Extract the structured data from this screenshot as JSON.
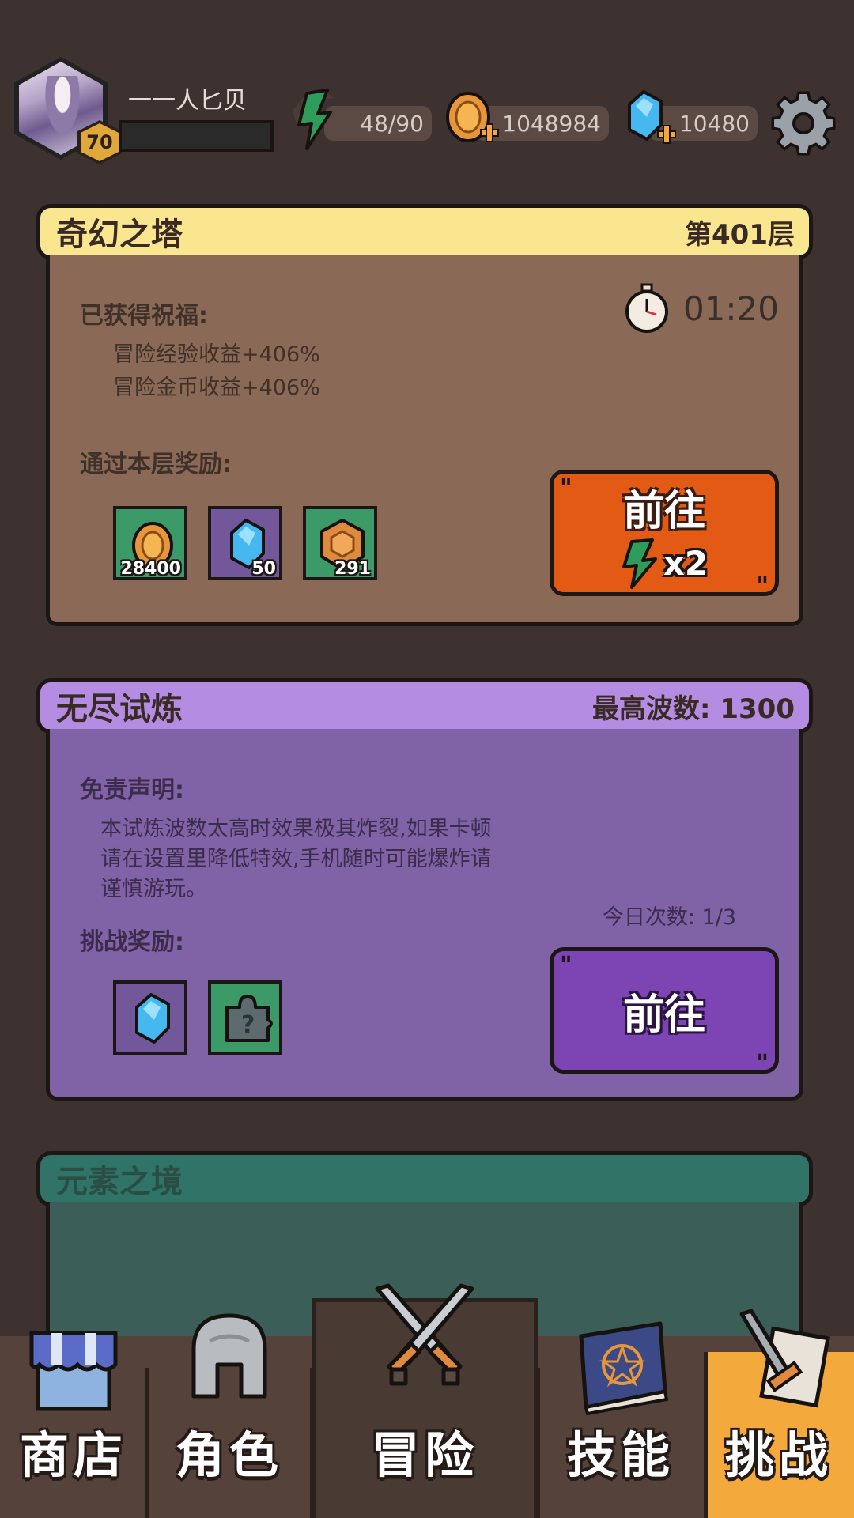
{
  "player": {
    "name": "一一人匕贝",
    "level": "70"
  },
  "resources": {
    "energy": "48/90",
    "gold": "1048984",
    "gems": "10480"
  },
  "tower": {
    "title": "奇幻之塔",
    "floor": "第401层",
    "timer": "01:20",
    "blessing_label": "已获得祝福:",
    "blessings": [
      "冒险经验收益+406%",
      "冒险金币收益+406%"
    ],
    "reward_label": "通过本层奖励:",
    "rewards": [
      {
        "icon": "gold-coin-icon",
        "qty": "28400"
      },
      {
        "icon": "blue-gem-icon",
        "qty": "50"
      },
      {
        "icon": "bronze-token-icon",
        "qty": "291"
      }
    ],
    "go_label": "前往",
    "cost": "x2"
  },
  "endless": {
    "title": "无尽试炼",
    "max_wave": "最高波数: 1300",
    "disclaimer_label": "免责声明:",
    "disclaimer_lines": [
      "本试炼波数太高时效果极其炸裂,如果卡顿",
      "请在设置里降低特效,手机随时可能爆炸请",
      "谨慎游玩。"
    ],
    "daily": "今日次数: 1/3",
    "reward_label": "挑战奖励:",
    "rewards": [
      {
        "icon": "blue-gem-icon"
      },
      {
        "icon": "mystery-puzzle-icon"
      }
    ],
    "go_label": "前往"
  },
  "element": {
    "title": "元素之境"
  },
  "nav": {
    "shop": "商店",
    "role": "角色",
    "adventure": "冒险",
    "skill": "技能",
    "challenge": "挑战",
    "active": "challenge"
  },
  "colors": {
    "background": "#3d3230",
    "tower_header": "#fbe690",
    "endless_header": "#b48de3",
    "element_header": "#2f7467",
    "go_orange": "#e25a14",
    "go_purple": "#7d45b3",
    "nav_active": "#f4a93c"
  }
}
